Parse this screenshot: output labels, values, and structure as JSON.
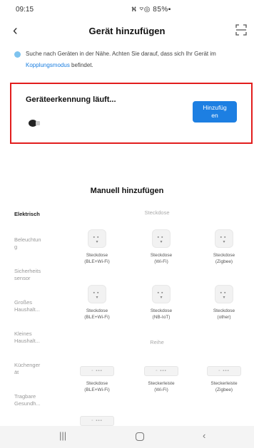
{
  "status_bar": {
    "time": "09:15",
    "icons": "⛕ ⌔◎ 85%▪"
  },
  "header": {
    "title": "Gerät hinzufügen"
  },
  "hint": {
    "text_before": "Suche nach Geräten in der Nähe. Achten Sie darauf, dass sich Ihr Gerät im ",
    "link": "Kopplungsmodus",
    "text_after": " befindet."
  },
  "discovery": {
    "title": "Geräteerkennung läuft...",
    "button_line1": "Hinzufüg",
    "button_line2": "en"
  },
  "manual": {
    "title": "Manuell hinzufügen"
  },
  "sidebar": {
    "items": [
      {
        "line1": "Elektrisch",
        "line2": ""
      },
      {
        "line1": "Beleuchtun",
        "line2": "g"
      },
      {
        "line1": "Sicherheits",
        "line2": "sensor"
      },
      {
        "line1": "Großes",
        "line2": "Haushalt..."
      },
      {
        "line1": "Kleines",
        "line2": "Haushalt..."
      },
      {
        "line1": "Küchenger",
        "line2": "ät"
      },
      {
        "line1": "Tragbare",
        "line2": "Gesundh..."
      }
    ]
  },
  "sections": {
    "steckdose": "Steckdose",
    "reihe": "Reihe"
  },
  "devices": [
    {
      "line1": "Steckdose",
      "line2": "(BLE+Wi-Fi)"
    },
    {
      "line1": "Steckdose",
      "line2": "(Wi-Fi)"
    },
    {
      "line1": "Steckdose",
      "line2": "(Zigbee)"
    },
    {
      "line1": "Steckdose",
      "line2": "(BLE+Wi-Fi)"
    },
    {
      "line1": "Steckdose",
      "line2": "(NB-IoT)"
    },
    {
      "line1": "Steckdose",
      "line2": "(other)"
    },
    {
      "line1": "Steckdose",
      "line2": "(BLE+Wi-Fi)"
    },
    {
      "line1": "Steckerleiste",
      "line2": "(Wi-Fi)"
    },
    {
      "line1": "Steckerleiste",
      "line2": "(Zigbee)"
    }
  ],
  "icons": {
    "back": "chevron-left-icon",
    "scan": "scan-icon",
    "hint": "bluetooth-search-icon",
    "socket": "socket-icon",
    "strip": "power-strip-icon"
  },
  "colors": {
    "accent": "#1d7fe2",
    "highlight_border": "#e21d1d",
    "link": "#1a7ee0"
  }
}
